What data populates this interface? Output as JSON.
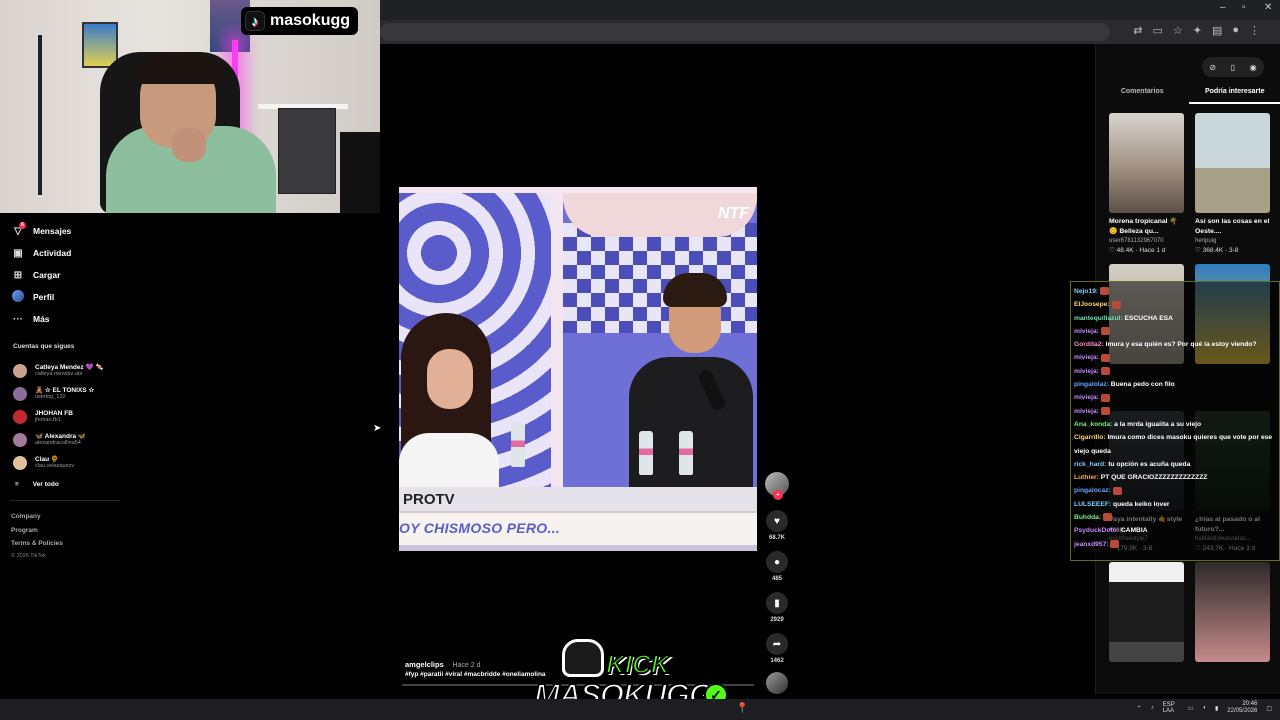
{
  "stream": {
    "brand": "masokugg",
    "kick_label": "KICK",
    "kick_name": "MASOKUGG"
  },
  "nav": [
    {
      "label": "Mensajes",
      "icon": "paper-plane-icon",
      "badge": "6"
    },
    {
      "label": "Actividad",
      "icon": "inbox-icon",
      "badge": ""
    },
    {
      "label": "Cargar",
      "icon": "plus-square-icon",
      "badge": ""
    },
    {
      "label": "Perfil",
      "icon": "avatar",
      "badge": ""
    },
    {
      "label": "Más",
      "icon": "more-icon",
      "badge": ""
    }
  ],
  "following": {
    "title": "Cuentas que sigues",
    "accounts": [
      {
        "name": "Catleya Mendez 💜 🍬",
        "handle": "catleya.mendez.abr",
        "color": "#c9a38f"
      },
      {
        "name": "🧸 ☆ EL TONIXS ☆",
        "handle": "usertop_132",
        "color": "#8c6a9a"
      },
      {
        "name": "JHOHAN FB",
        "handle": "jhohan.fb1",
        "color": "#c02a30"
      },
      {
        "name": "🦋 Alexandra 🦋",
        "handle": "alexandracollina54",
        "color": "#a27a9a"
      },
      {
        "name": "Clau 🌻",
        "handle": "clau.velasquezv",
        "color": "#e0c19a"
      }
    ],
    "see_all": "Ver todo"
  },
  "footer": {
    "links": [
      "Company",
      "Program",
      "Terms & Policies"
    ],
    "copyright": "© 2026 TikTok"
  },
  "video": {
    "caption_text": "OY CHISMOSO PERO...",
    "logo": "NTF",
    "author": "amgelclips",
    "posted": "· Hace 2 d",
    "hashtags": "#fyp #paratii #viral #macbridde #oneliamolina",
    "progress": 0.0
  },
  "actions": {
    "likes": "68.7K",
    "comments": "485",
    "saves": "2929",
    "shares": "1462"
  },
  "right_panel": {
    "tabs": [
      "Comentarios",
      "Podría interesarte"
    ],
    "active_tab": 1,
    "cards": [
      {
        "title": "Morena tropicanal 🌴 😊 Belleza qu...",
        "user": "user6781132967070",
        "likes": "48.4K",
        "time": "Hace 1 d",
        "bg": "linear-gradient(#d8d5cf,#9a8a7a 60%,#5c5048)"
      },
      {
        "title": "Así son las cosas en el Oeste....",
        "user": "heripuig",
        "likes": "368.4K",
        "time": "3-8",
        "bg": "linear-gradient(#c9d6da 0 55%,#a7a287 55%)"
      },
      {
        "title": "",
        "user": "",
        "likes": "",
        "time": "",
        "bg": "linear-gradient(#d4cfc4,#9f978a)"
      },
      {
        "title": "",
        "user": "",
        "likes": "",
        "time": "",
        "bg": "linear-gradient(#2e7cc4,#e5c33b)"
      },
      {
        "title": "Vaya intentally 🤙style #rap...",
        "user": "erickfreestyle7",
        "likes": "179.9K",
        "time": "3-8",
        "bg": "linear-gradient(#3a3f44,#1b1e22)"
      },
      {
        "title": "¿Irías al pasado o al futuro?...",
        "user": "hablandohuevadas...",
        "likes": "243.7K",
        "time": "Hace 3 d",
        "bg": "linear-gradient(#2a3b2a,#0f1a12)"
      },
      {
        "title": "",
        "user": "",
        "likes": "",
        "time": "",
        "bg": "linear-gradient(#f0f0f0 0 20%,#1d1d1d 20% 80%,#444 80%)"
      },
      {
        "title": "",
        "user": "",
        "likes": "",
        "time": "",
        "bg": "linear-gradient(#2d2a2a,#c68a8a)"
      }
    ]
  },
  "chat": [
    {
      "user": "Nejo19:",
      "color": "#7fd0ff",
      "text": "",
      "emote": true
    },
    {
      "user": "ElJoosepe:",
      "color": "#ffd76a",
      "text": "",
      "emote": true
    },
    {
      "user": "mantequillazul:",
      "color": "#6fe3b0",
      "text": "ESCUCHA ESA",
      "emote": false
    },
    {
      "user": "mivieja:",
      "color": "#c58cff",
      "text": "",
      "emote": true
    },
    {
      "user": "Gordita2:",
      "color": "#ff8fc7",
      "text": "Imura y esa quién es? Por qué la estoy viendo?",
      "emote": false
    },
    {
      "user": "mivieja:",
      "color": "#c58cff",
      "text": "",
      "emote": true
    },
    {
      "user": "mivieja:",
      "color": "#c58cff",
      "text": "",
      "emote": true
    },
    {
      "user": "pingalolaz:",
      "color": "#66a3ff",
      "text": "Buena pedo con filo",
      "emote": false
    },
    {
      "user": "mivieja:",
      "color": "#c58cff",
      "text": "",
      "emote": true
    },
    {
      "user": "mivieja:",
      "color": "#c58cff",
      "text": "",
      "emote": true
    },
    {
      "user": "Ana_konda:",
      "color": "#7bf07b",
      "text": "a la mrda iguaiita a su viejo",
      "emote": false
    },
    {
      "user": "Cigarrillo:",
      "color": "#ffd76a",
      "text": "Imura como dices masoku quieres que vote por ese viejo queda",
      "emote": false
    },
    {
      "user": "rick_hard:",
      "color": "#7fd0ff",
      "text": "tu opción es acuña queda",
      "emote": false
    },
    {
      "user": "Luthier:",
      "color": "#ffb04d",
      "text": "PT QUE GRACIOZZZZZZZZZZZZZ",
      "emote": false
    },
    {
      "user": "pingalocaz:",
      "color": "#66a3ff",
      "text": "",
      "emote": true
    },
    {
      "user": "LULSEEEF:",
      "color": "#7fd0ff",
      "text": "queda keiko lover",
      "emote": false
    },
    {
      "user": "Buhdda:",
      "color": "#7bf07b",
      "text": "",
      "emote": true
    },
    {
      "user": "PsyduckDoto:",
      "color": "#c58cff",
      "text": "CAMBIA",
      "emote": false
    },
    {
      "user": "jeanxd957:",
      "color": "#c58cff",
      "text": "",
      "emote": true
    }
  ],
  "taskbar": {
    "lang": "ESP LAA",
    "time": "20:46",
    "date": "22/05/2026"
  }
}
